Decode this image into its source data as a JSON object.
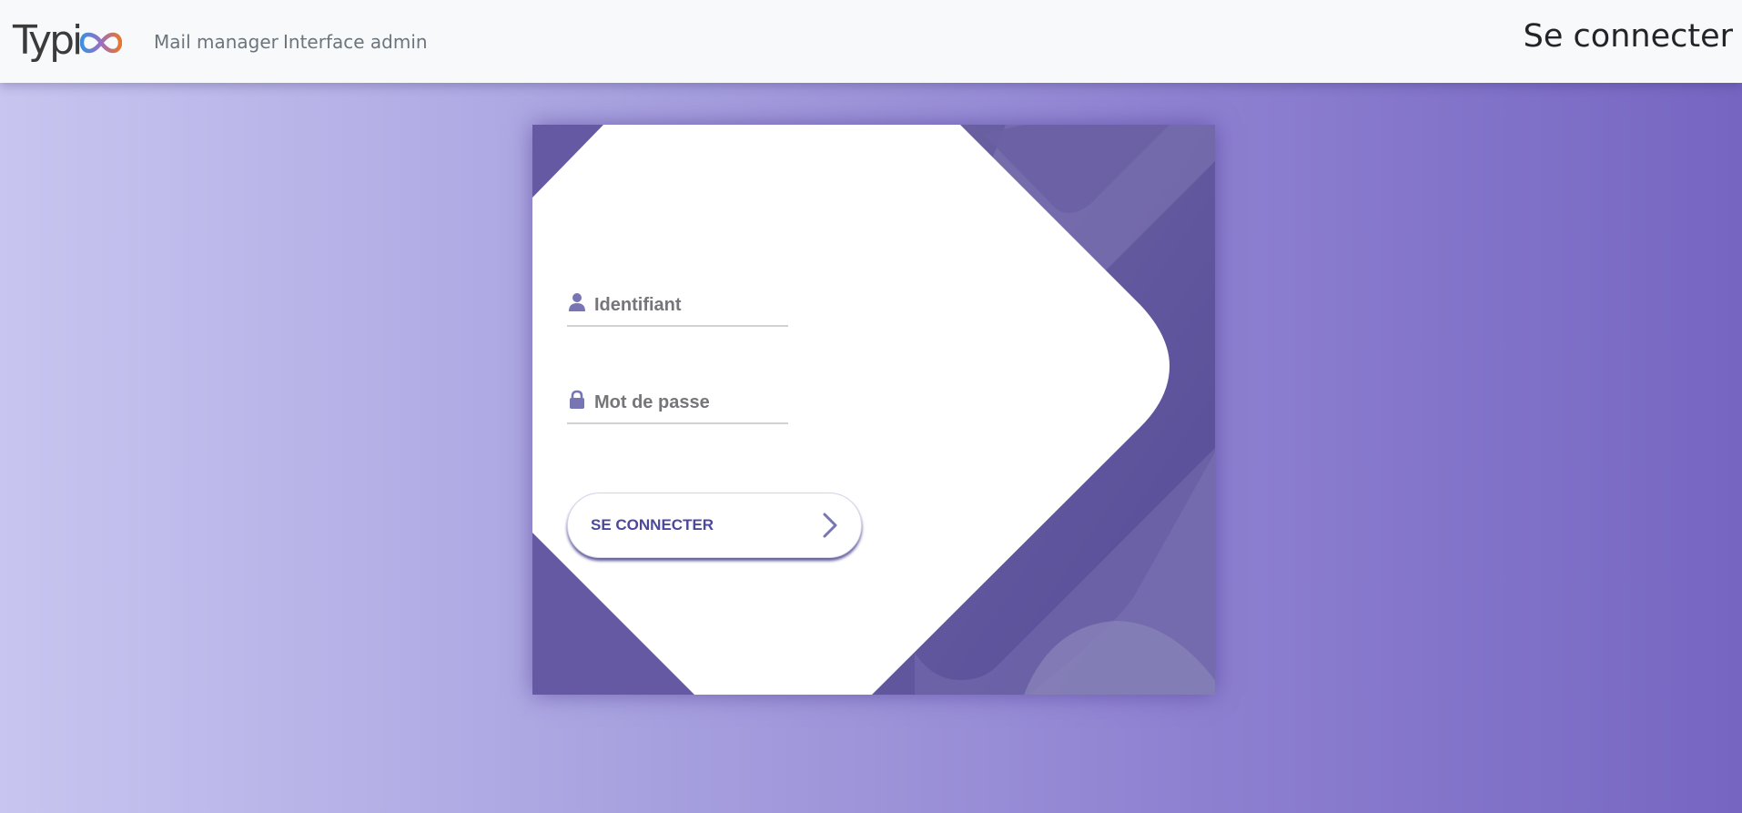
{
  "navbar": {
    "logo_text": "Typi",
    "links": [
      "Mail manager",
      "Interface admin"
    ],
    "title": "Se connecter"
  },
  "login": {
    "username_placeholder": "Identifiant",
    "password_placeholder": "Mot de passe",
    "submit_label": "SE CONNECTER"
  },
  "icons": {
    "username": "user-icon",
    "password": "lock-icon",
    "submit": "chevron-right-icon"
  },
  "colors": {
    "accent": "#4c489d",
    "card_purple": "#5d4f9c",
    "icon_purple": "#7875b5",
    "logo_blue": "#3d8fe0",
    "logo_orange": "#e8772e"
  }
}
